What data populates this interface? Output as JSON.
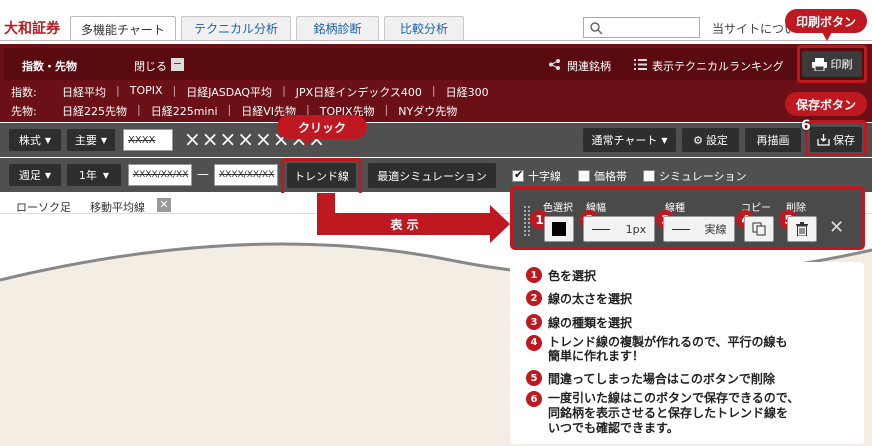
{
  "logo": "大和証券",
  "tabs": [
    "多機能チャート",
    "テクニカル分析",
    "銘柄診断",
    "比較分析"
  ],
  "site_link": "当サイトについて",
  "callouts": {
    "print": "印刷ボタン",
    "save": "保存ボタン",
    "click": "クリック",
    "display": "表 示"
  },
  "header": {
    "section_title": "指数・先物",
    "close_label": "閉じる",
    "close_icon": "−",
    "related": "関連銘柄",
    "ranking": "表示テクニカルランキング",
    "print": "印刷"
  },
  "index_row": {
    "label": "指数:",
    "items": [
      "日経平均",
      "TOPIX",
      "日経JASDAQ平均",
      "JPX日経インデックス400",
      "日経300"
    ]
  },
  "futures_row": {
    "label": "先物:",
    "items": [
      "日経225先物",
      "日経225mini",
      "日経VI先物",
      "TOPIX先物",
      "NYダウ先物"
    ]
  },
  "toolbar1": {
    "stock_select": "株式",
    "market_select": "主要",
    "code_input": "XXXX",
    "stock_name": "××××××××",
    "chart_type": "通常チャート",
    "settings": "設定",
    "redraw": "再描画",
    "save": "保存",
    "save_num": "6"
  },
  "toolbar2": {
    "period_type": "週足",
    "span": "1年",
    "date_from": "XXXX/XX/XX",
    "dash": "—",
    "date_to": "XXXX/XX/XX",
    "trendline": "トレンド線",
    "simulation": "最適シミュレーション",
    "check_crosshair": "十字線",
    "check_price_band": "価格帯",
    "check_simulation": "シミュレーション"
  },
  "chart_tags": {
    "candle": "ローソク足",
    "ma": "移動平均線"
  },
  "panel": {
    "color_label": "色選択",
    "width_label": "線幅",
    "width_value": "1px",
    "type_label": "線種",
    "type_value": "実線",
    "copy_label": "コピー",
    "delete_label": "削除",
    "nums": [
      "1",
      "2",
      "3",
      "4",
      "5"
    ]
  },
  "legend": [
    {
      "num": "1",
      "text": "色を選択"
    },
    {
      "num": "2",
      "text": "線の太さを選択"
    },
    {
      "num": "3",
      "text": "線の種類を選択"
    },
    {
      "num": "4",
      "text": "トレンド線の複製が作れるので、平行の線も\n簡単に作れます！"
    },
    {
      "num": "5",
      "text": "間違ってしまった場合はこのボタンで削除"
    },
    {
      "num": "6",
      "text": "一度引いた線はこのボタンで保存できるので、\n同銘柄を表示させると保存したトレンド線を\nいつでも確認できます。"
    }
  ],
  "colors": {
    "accent": "#c01820",
    "dark_header": "#6b1016",
    "toolbar": "#505050"
  }
}
